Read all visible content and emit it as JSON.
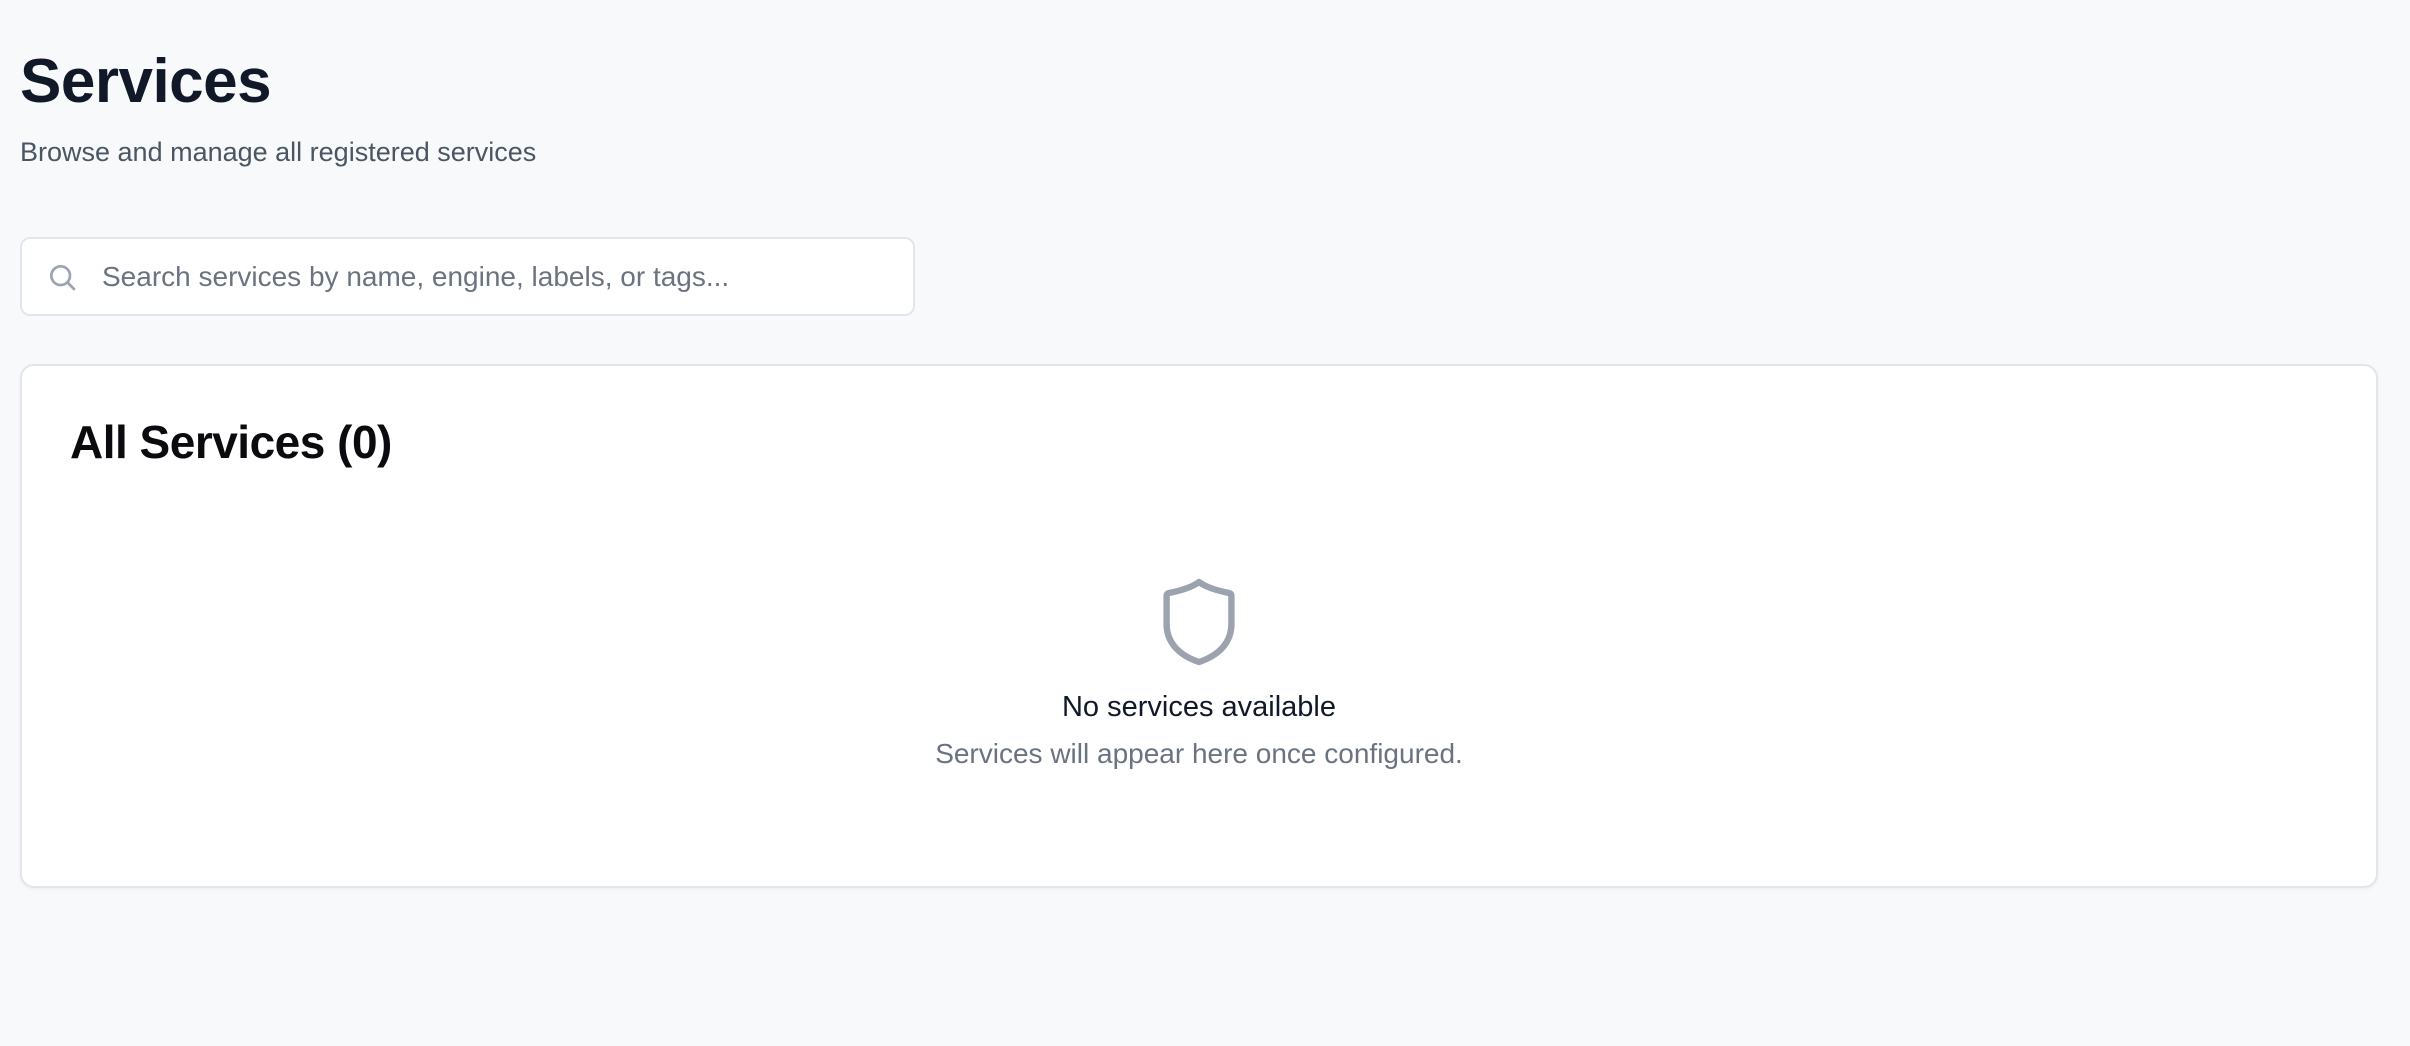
{
  "header": {
    "title": "Services",
    "subtitle": "Browse and manage all registered services"
  },
  "search": {
    "placeholder": "Search services by name, engine, labels, or tags...",
    "value": "",
    "icon": "search-icon"
  },
  "services_card": {
    "title": "All Services (0)",
    "empty_state": {
      "icon": "shield-icon",
      "title": "No services available",
      "description": "Services will appear here once configured."
    }
  },
  "colors": {
    "background": "#f8f9fb",
    "card": "#ffffff",
    "border": "#e2e5ea",
    "text_primary": "#111827",
    "text_secondary": "#6b7280",
    "icon_gray": "#9ca3af"
  }
}
